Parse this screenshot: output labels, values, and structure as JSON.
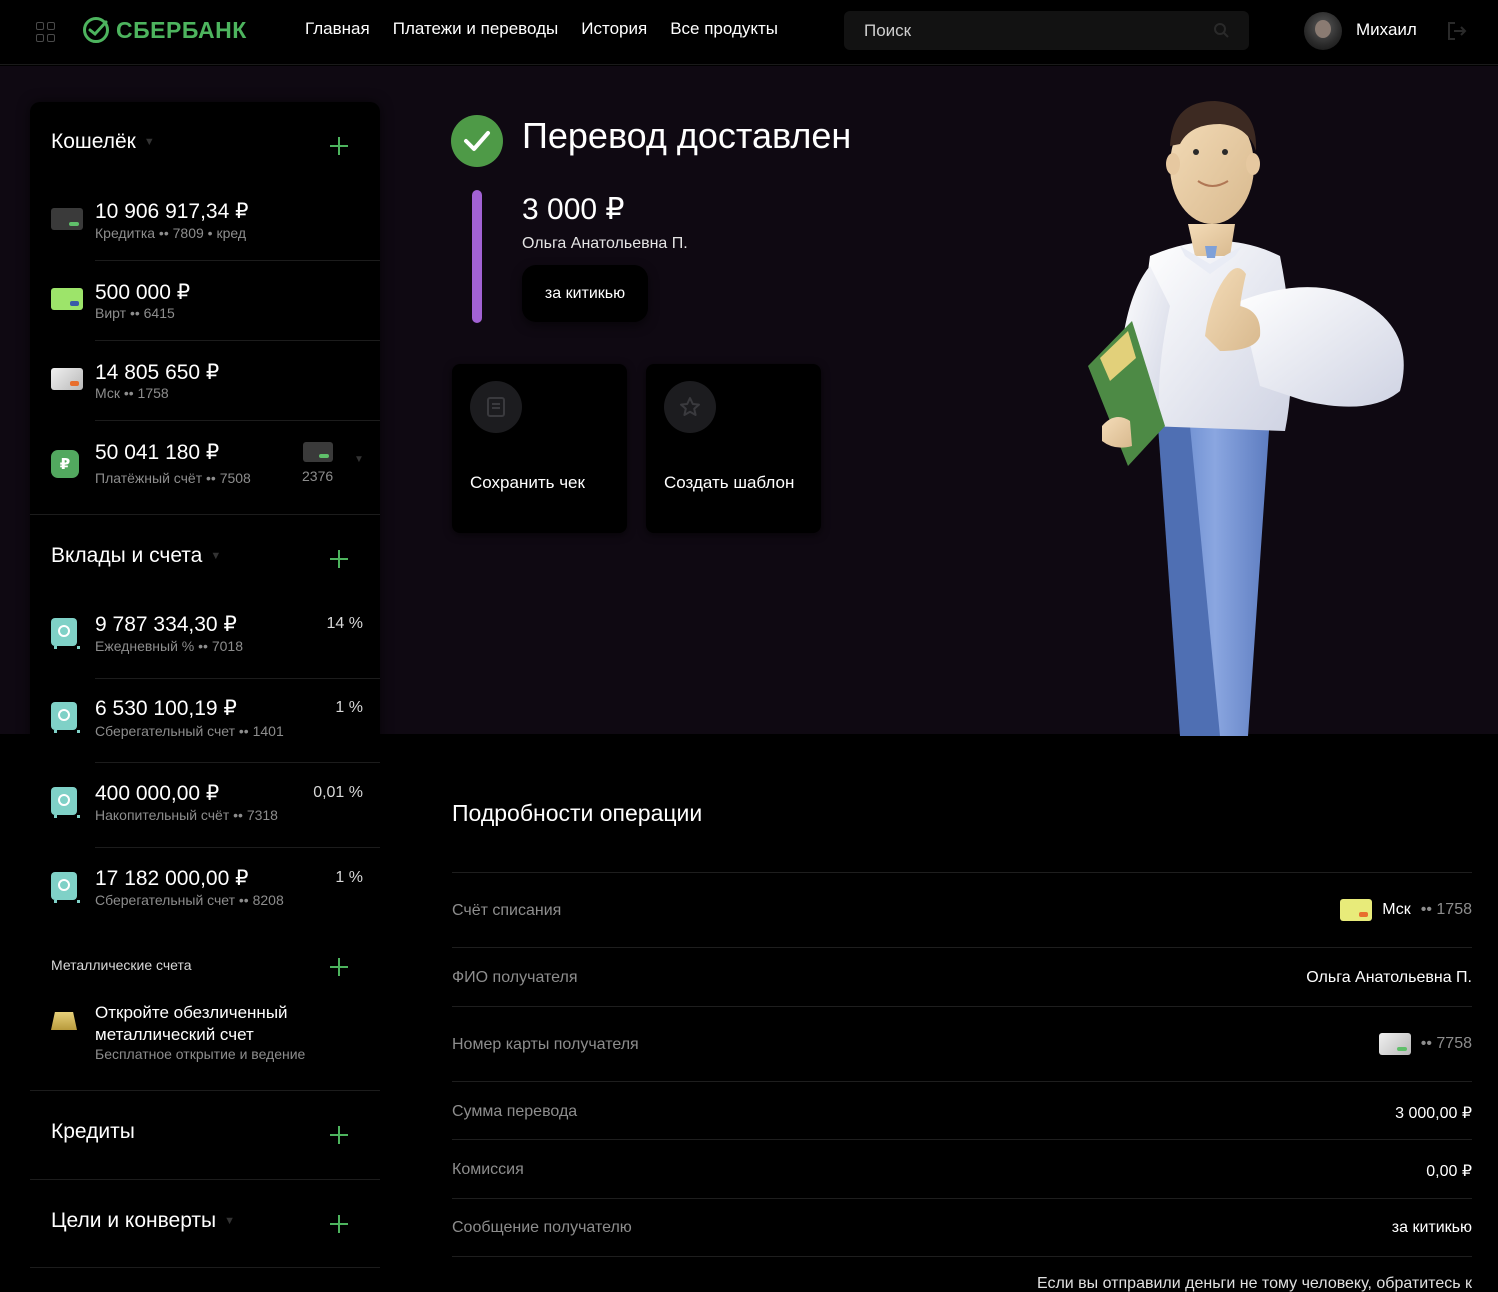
{
  "header": {
    "logo_text": "СБЕРБАНК",
    "nav": [
      "Главная",
      "Платежи и переводы",
      "История",
      "Все продукты"
    ],
    "search_placeholder": "Поиск",
    "user_name": "Михаил",
    "brand_color": "#4db45e"
  },
  "sidebar": {
    "wallet": {
      "title": "Кошелёк",
      "items": [
        {
          "amount": "10 906 917,34 ₽",
          "sub": "Кредитка •• 7809 • кред",
          "icon": "credit-card-icon"
        },
        {
          "amount": "500 000 ₽",
          "sub": "Вирт •• 6415",
          "icon": "virtual-card-icon"
        },
        {
          "amount": "14 805 650 ₽",
          "sub": "Мск •• 1758",
          "icon": "card-icon"
        },
        {
          "amount": "50 041 180 ₽",
          "sub": "Платёжный счёт •• 7508",
          "icon": "ruble-icon",
          "linked_card": "2376"
        }
      ]
    },
    "deposits": {
      "title": "Вклады и счета",
      "items": [
        {
          "amount": "9 787 334,30 ₽",
          "sub": "Ежедневный % •• 7018",
          "rate": "14 %"
        },
        {
          "amount": "6 530 100,19 ₽",
          "sub": "Сберегательный счет •• 1401",
          "rate": "1 %"
        },
        {
          "amount": "400 000,00 ₽",
          "sub": "Накопительный счёт •• 7318",
          "rate": "0,01 %"
        },
        {
          "amount": "17 182 000,00 ₽",
          "sub": "Сберегательный счет •• 8208",
          "rate": "1 %"
        }
      ]
    },
    "metal": {
      "title": "Металлические счета",
      "text": "Откройте обезличенный металлический счет",
      "sub": "Бесплатное открытие и ведение"
    },
    "credits": {
      "title": "Кредиты"
    },
    "goals": {
      "title": "Цели и конверты"
    }
  },
  "hero": {
    "title": "Перевод доставлен",
    "amount": "3 000 ₽",
    "recipient": "Ольга Анатольевна П.",
    "message": "за китикью",
    "actions": [
      {
        "label": "Сохранить чек",
        "icon": "receipt-icon"
      },
      {
        "label": "Создать шаблон",
        "icon": "star-icon"
      }
    ],
    "accent_color": "#a262d4",
    "success_color": "#4e9a47"
  },
  "details": {
    "title": "Подробности операции",
    "rows": [
      {
        "label": "Счёт списания",
        "value": "Мск",
        "suffix": "•• 1758"
      },
      {
        "label": "ФИО получателя",
        "value": "Ольга Анатольевна П."
      },
      {
        "label": "Номер карты получателя",
        "value": "•• 7758"
      },
      {
        "label": "Сумма перевода",
        "value": "3 000,00 ₽"
      },
      {
        "label": "Комиссия",
        "value": "0,00 ₽"
      },
      {
        "label": "Сообщение получателю",
        "value": "за китикью"
      }
    ],
    "footnote": "Если вы отправили деньги не тому человеку, обратитесь к"
  }
}
